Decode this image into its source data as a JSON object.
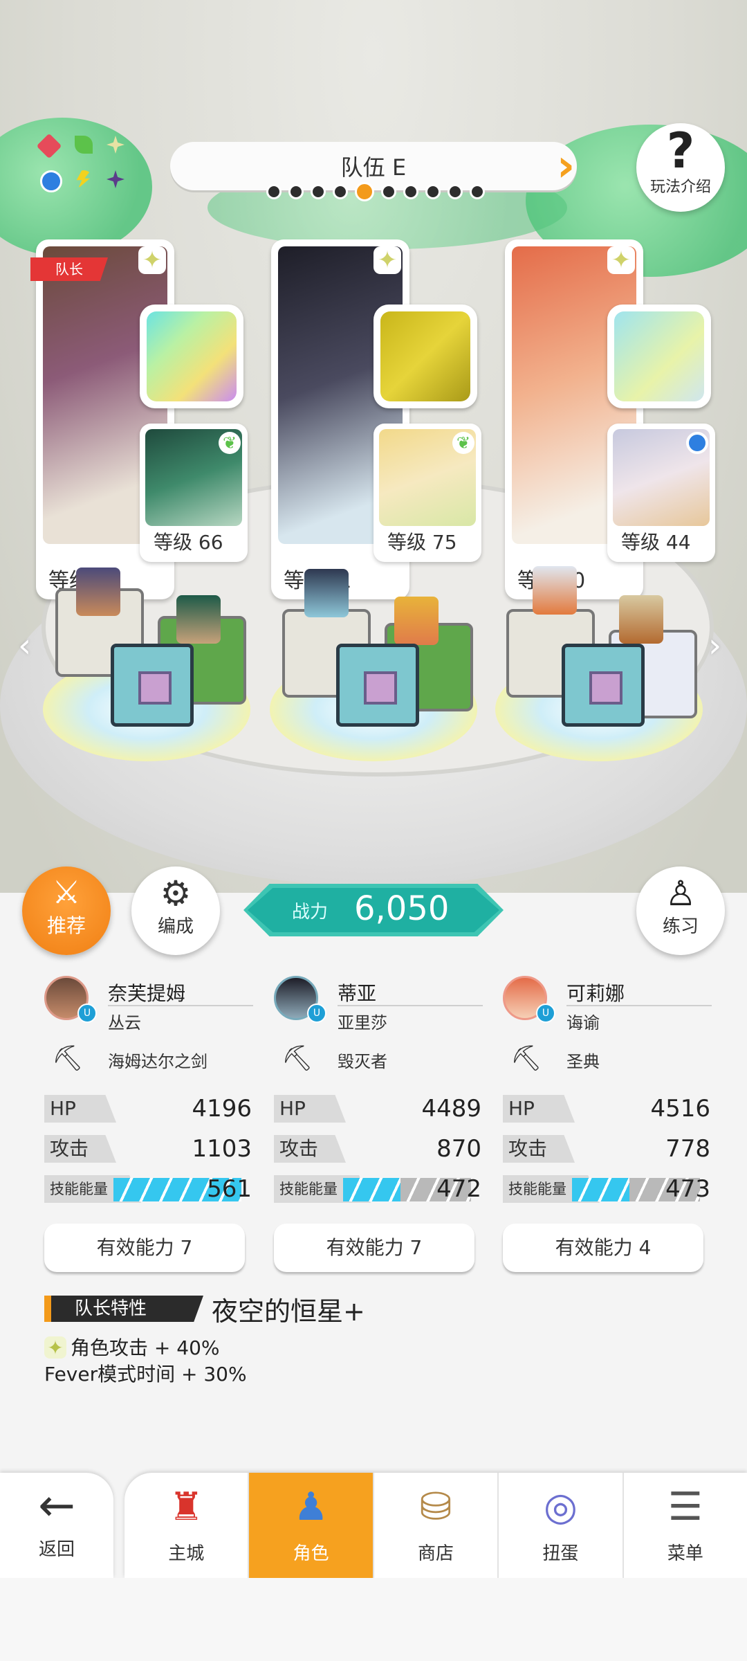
{
  "team": {
    "name": "队伍 E",
    "page_count": 10,
    "active_page": 5,
    "help_label": "玩法介绍"
  },
  "slots": [
    {
      "leader_tag": "队长",
      "level": "等级80",
      "sub_level": "等级 66",
      "name": "奈芙提姆",
      "sub_name": "丛云",
      "weapon": "海姆达尔之剑",
      "hp_label": "HP",
      "hp": "4196",
      "atk_label": "攻击",
      "atk": "1103",
      "energy_label": "技能能量",
      "energy": "561",
      "energy_fill": 1.0,
      "effective": "有效能力 7"
    },
    {
      "leader_tag": "",
      "level": "等级71",
      "sub_level": "等级 75",
      "name": "蒂亚",
      "sub_name": "亚里莎",
      "weapon": "毁灭者",
      "hp_label": "HP",
      "hp": "4489",
      "atk_label": "攻击",
      "atk": "870",
      "energy_label": "技能能量",
      "energy": "472",
      "energy_fill": 0.45,
      "effective": "有效能力 7"
    },
    {
      "leader_tag": "",
      "level": "等级80",
      "sub_level": "等级 44",
      "name": "可莉娜",
      "sub_name": "诲谕",
      "weapon": "圣典",
      "hp_label": "HP",
      "hp": "4516",
      "atk_label": "攻击",
      "atk": "778",
      "energy_label": "技能能量",
      "energy": "473",
      "energy_fill": 0.45,
      "effective": "有效能力 4"
    }
  ],
  "buttons": {
    "recommend": "推荐",
    "formation": "编成",
    "practice": "练习"
  },
  "power": {
    "label": "战力",
    "value": "6,050"
  },
  "leader": {
    "tag": "队长特性",
    "skill": "夜空的恒星+",
    "effect1": "角色攻击 + 40%",
    "effect2": "Fever模式时间 + 30%"
  },
  "nav": {
    "back": "返回",
    "items": [
      "主城",
      "角色",
      "商店",
      "扭蛋",
      "菜单"
    ],
    "active": "角色"
  },
  "colors": {
    "accent": "#f6a11f",
    "power": "#1fb0a2",
    "energy": "#35c7ef",
    "leader_red": "#e43636"
  },
  "icons": {
    "back": "arrow-left-icon",
    "home": "castle-icon",
    "character": "character-icon",
    "shop": "shop-bag-icon",
    "gacha": "gacha-icon",
    "menu": "menu-list-icon"
  }
}
